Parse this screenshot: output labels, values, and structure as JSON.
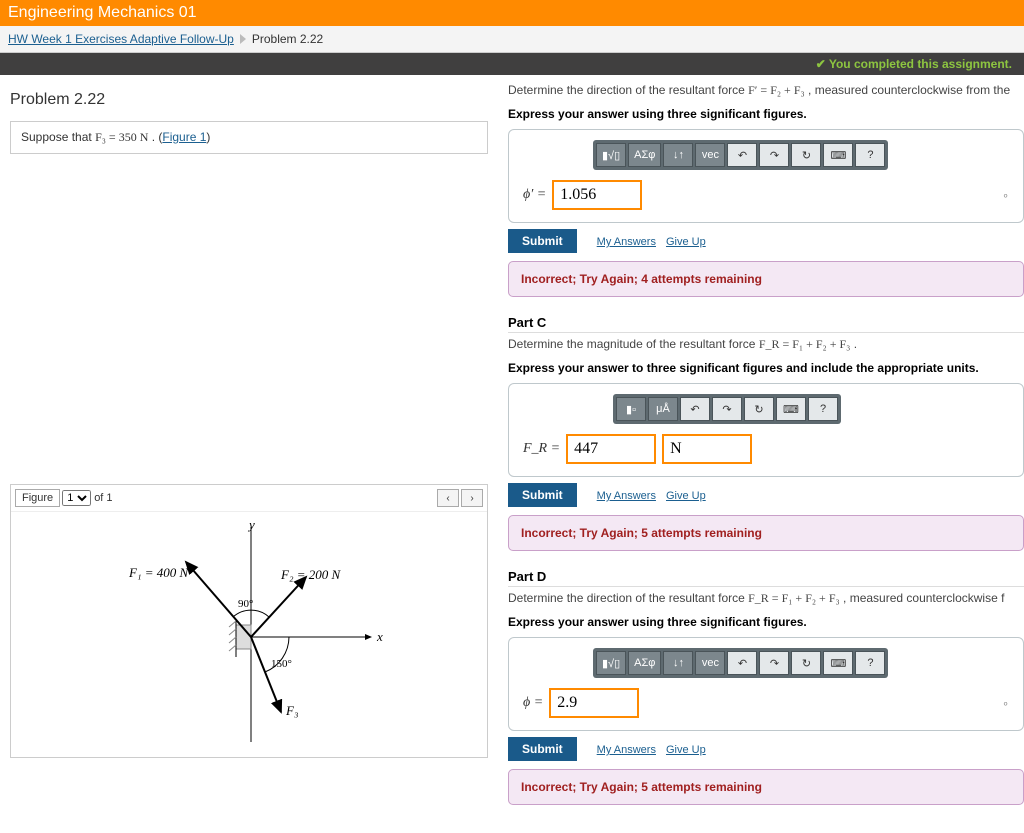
{
  "header": {
    "title": "Engineering Mechanics 01"
  },
  "breadcrumb": {
    "link": "HW Week 1 Exercises Adaptive Follow-Up",
    "current": "Problem 2.22"
  },
  "completed_msg": "You completed this assignment.",
  "problem": {
    "title": "Problem 2.22",
    "suppose_pre": "Suppose that ",
    "suppose_math": "F₃ = 350  N",
    "suppose_post": " . (",
    "figure_link": "Figure 1",
    "suppose_close": ")"
  },
  "figure": {
    "label": "Figure",
    "selected": "1",
    "of_text": "of 1",
    "prev": "‹",
    "next": "›",
    "y_label": "y",
    "x_label": "x",
    "F1": "F₁ = 400 N",
    "F2": "F₂ = 200 N",
    "F3": "F₃",
    "ang90": "90°",
    "ang150": "150°"
  },
  "toolbar": {
    "templates": "▮√▯",
    "greek": "ΑΣφ",
    "updown": "↓↑",
    "vec": "vec",
    "undo": "↶",
    "redo": "↷",
    "reset": "↻",
    "keyboard": "⌨",
    "help": "?",
    "xover": "▮▫",
    "units_btn": "μÅ"
  },
  "actions": {
    "submit": "Submit",
    "my_answers": "My Answers",
    "give_up": "Give Up"
  },
  "partB": {
    "prompt_pre": "Determine the direction of the resultant force ",
    "prompt_math": "F′ = F₂ + F₃",
    "prompt_post": ", measured counterclockwise from the",
    "express": "Express your answer using three significant figures.",
    "var": "ϕ′ =",
    "value": "1.056",
    "unit_mark": "∘",
    "feedback": "Incorrect; Try Again; 4 attempts remaining"
  },
  "partC": {
    "header": "Part C",
    "prompt_pre": "Determine the magnitude of the resultant force ",
    "prompt_math": "F_R = F₁ + F₂ + F₃",
    "prompt_post": ".",
    "express": "Express your answer to three significant figures and include the appropriate units.",
    "var": "F_R =",
    "value": "447",
    "unit": "N",
    "feedback": "Incorrect; Try Again; 5 attempts remaining"
  },
  "partD": {
    "header": "Part D",
    "prompt_pre": "Determine the direction of the resultant force ",
    "prompt_math": "F_R = F₁ + F₂ + F₃",
    "prompt_post": ", measured counterclockwise f",
    "express": "Express your answer using three significant figures.",
    "var": "ϕ =",
    "value": "2.9",
    "unit_mark": "∘",
    "feedback": "Incorrect; Try Again; 5 attempts remaining"
  }
}
